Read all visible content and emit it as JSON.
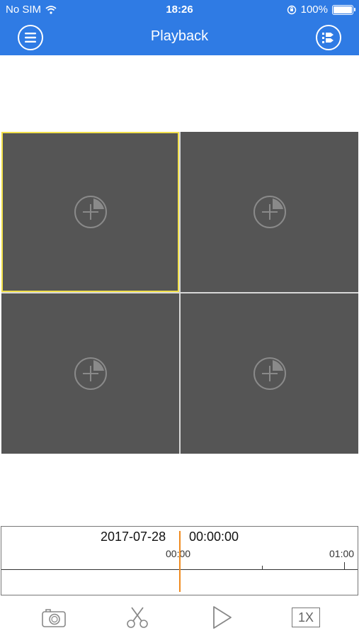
{
  "status_bar": {
    "carrier": "No SIM",
    "time": "18:26",
    "battery": "100%"
  },
  "nav": {
    "title": "Playback",
    "menu_icon": "menu-icon",
    "right_icon": "device-list-icon"
  },
  "grid": {
    "cells": [
      {
        "icon": "add-channel-icon",
        "selected": true
      },
      {
        "icon": "add-channel-icon",
        "selected": false
      },
      {
        "icon": "add-channel-icon",
        "selected": false
      },
      {
        "icon": "add-channel-icon",
        "selected": false
      }
    ]
  },
  "timeline": {
    "date": "2017-07-28",
    "time": "00:00:00",
    "tick_start": "00:00",
    "tick_end": "01:00"
  },
  "toolbar": {
    "speed": "1X",
    "icons": [
      "camera-icon",
      "scissors-icon",
      "play-icon"
    ]
  },
  "colors": {
    "accent": "#2f7be4",
    "selected_border": "#f2e04a",
    "timeline_cursor": "#f08a1e",
    "cell_bg": "#555555"
  }
}
